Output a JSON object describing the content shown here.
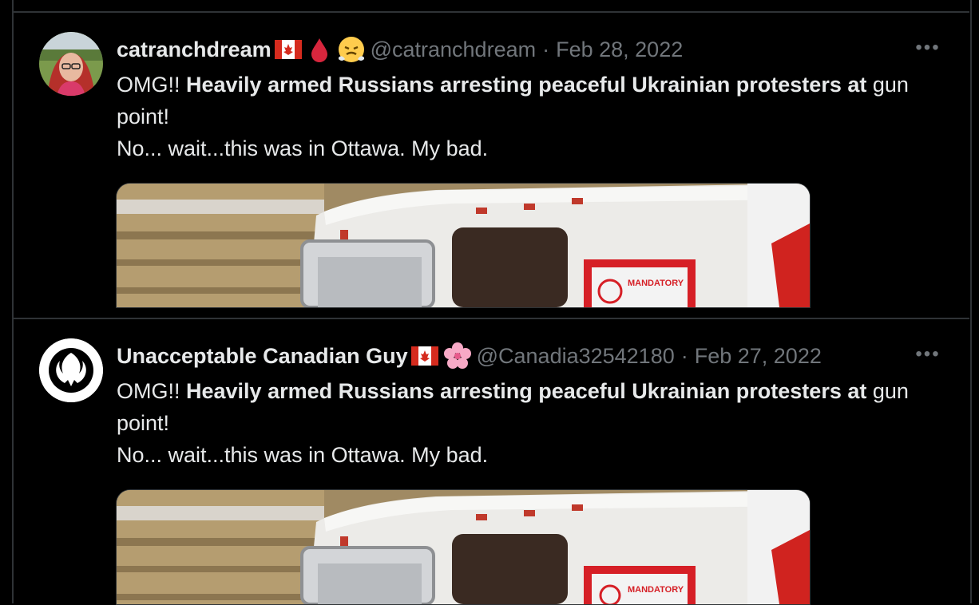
{
  "tweets": [
    {
      "display_name": "catranchdream",
      "flag": "canada-flag",
      "emojis": [
        "drop-of-blood-emoji",
        "face-with-steam-emoji"
      ],
      "handle": "@catranchdream",
      "separator": "·",
      "date": "Feb 28, 2022",
      "more": "•••",
      "text_intro": "OMG!! ",
      "text_bold": "Heavily armed Russians arresting peaceful Ukrainian protesters at",
      "text_rest": " gun point!",
      "text_line2": "No... wait...this was in Ottawa. My bad."
    },
    {
      "display_name": "Unacceptable Canadian Guy",
      "flag": "canada-flag",
      "emojis": [
        "cherry-blossom-emoji"
      ],
      "handle": "@Canadia32542180",
      "separator": "·",
      "date": "Feb 27, 2022",
      "more": "•••",
      "text_intro": "OMG!! ",
      "text_bold": "Heavily armed Russians arresting peaceful Ukrainian protesters at",
      "text_rest": " gun point!",
      "text_line2": "No... wait...this was in Ottawa. My bad."
    }
  ],
  "media_sign_text": "MANDATORY"
}
